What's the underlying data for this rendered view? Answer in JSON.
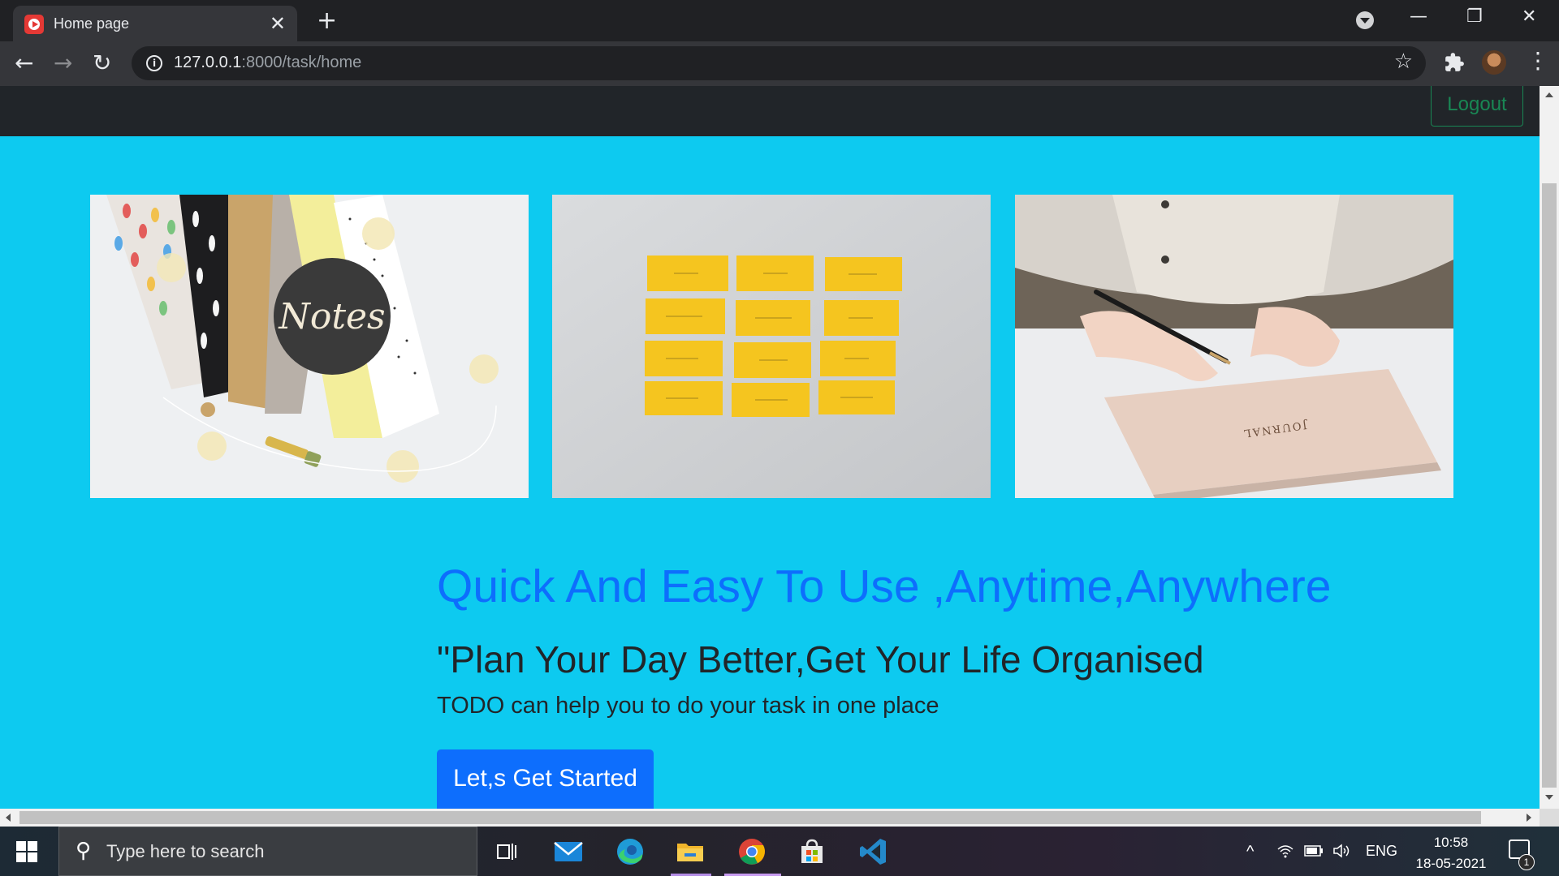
{
  "browser": {
    "tab_title": "Home page",
    "tab_close": "✕",
    "new_tab": "+",
    "url_host": "127.0.0.1",
    "url_path": ":8000/task/home",
    "window_controls": {
      "minimize": "—",
      "restore": "❐",
      "close": "✕"
    }
  },
  "site": {
    "nav": {
      "logout_label": "Logout"
    },
    "hero": {
      "title": "Quick And Easy To Use ,Anytime,Anywhere",
      "subtitle": "\"Plan Your Day Better,Get Your Life Organised",
      "text": "TODO can help you to do your task in one place",
      "cta_label": "Let,s Get Started"
    },
    "images": [
      {
        "name": "notes-notebooks-image",
        "label": "Notes"
      },
      {
        "name": "sticky-notes-image"
      },
      {
        "name": "journal-writing-image",
        "label": "JOURNAL"
      }
    ]
  },
  "taskbar": {
    "search_placeholder": "Type here to search",
    "language": "ENG",
    "time": "10:58",
    "date": "18-05-2021",
    "notification_count": "1"
  },
  "colors": {
    "page_bg": "#0dcaf0",
    "navbar_bg": "#212529",
    "logout_green": "#198754",
    "primary_blue": "#0d6efd"
  }
}
